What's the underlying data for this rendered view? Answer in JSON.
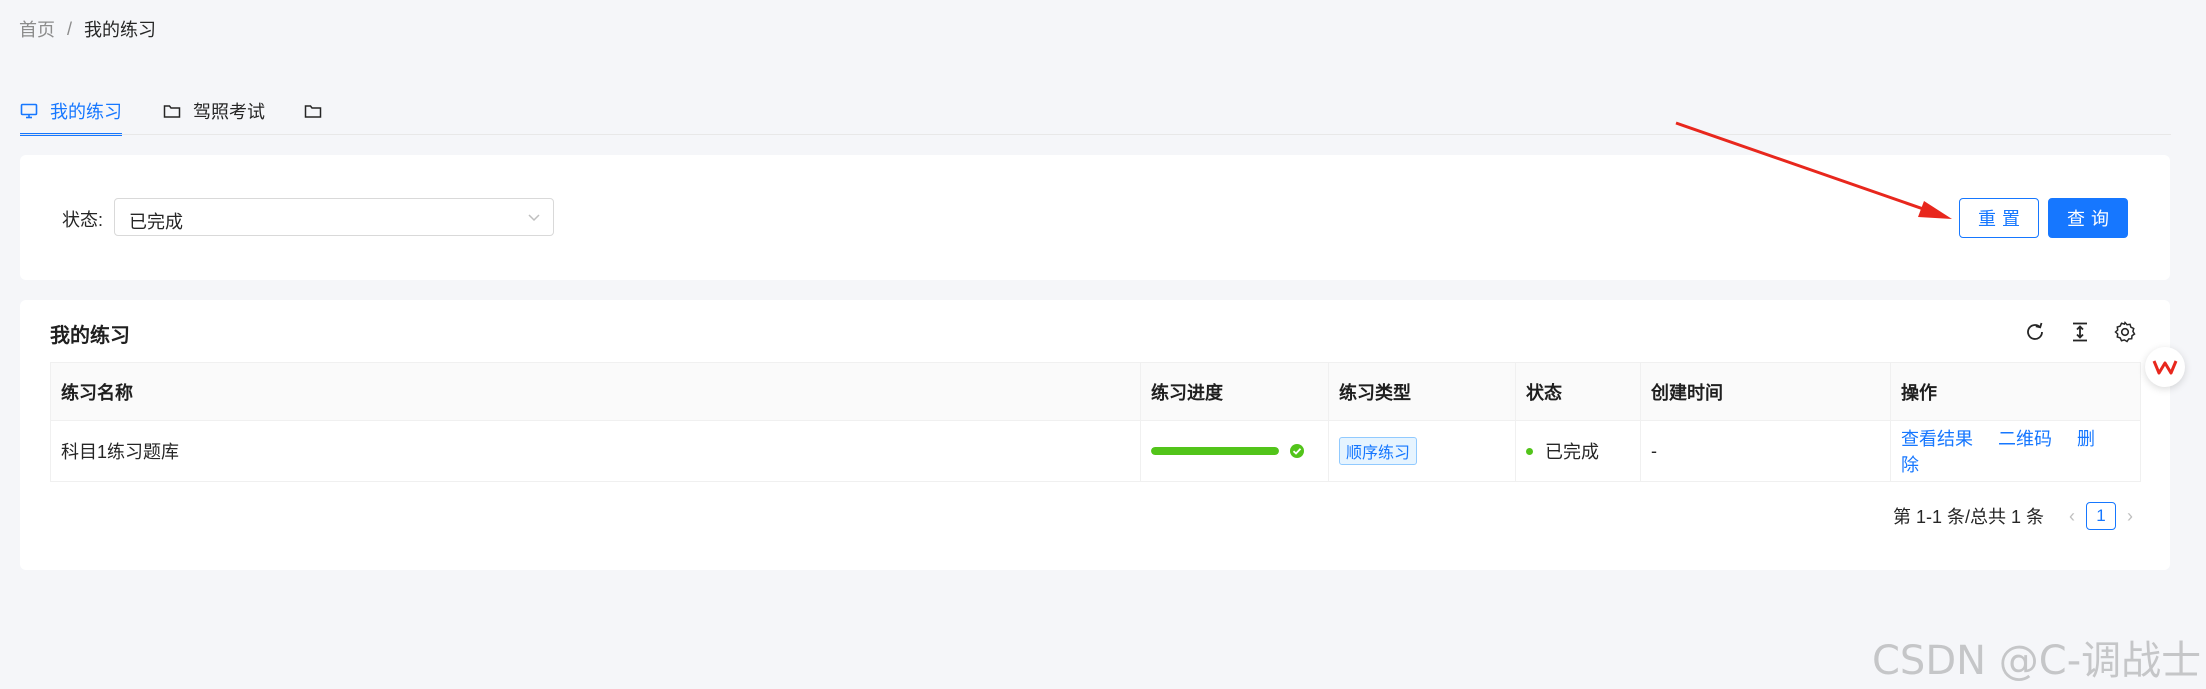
{
  "breadcrumb": {
    "home": "首页",
    "separator": "/",
    "current": "我的练习"
  },
  "tabs": [
    {
      "label": "我的练习",
      "icon": "monitor-icon",
      "active": true
    },
    {
      "label": "驾照考试",
      "icon": "folder-icon",
      "active": false
    },
    {
      "label": "",
      "icon": "folder-icon",
      "active": false
    }
  ],
  "filter": {
    "status_label": "状态:",
    "status_value": "已完成",
    "reset_label": "重置",
    "query_label": "查询"
  },
  "table": {
    "title": "我的练习",
    "toolbar": [
      "reload-icon",
      "column-height-icon",
      "setting-icon"
    ],
    "columns": [
      "练习名称",
      "练习进度",
      "练习类型",
      "状态",
      "创建时间",
      "操作"
    ],
    "rows": [
      {
        "name": "科目1练习题库",
        "progress": 100,
        "type": "顺序练习",
        "status": "已完成",
        "created": "-",
        "actions": [
          "查看结果",
          "二维码",
          "删除"
        ]
      }
    ]
  },
  "pagination": {
    "total_text": "第 1-1 条/总共 1 条",
    "current_page": "1"
  },
  "colors": {
    "primary": "#1677ff",
    "success": "#52c41a",
    "annotation": "#e8271d"
  },
  "watermark": "CSDN @C-调战士"
}
